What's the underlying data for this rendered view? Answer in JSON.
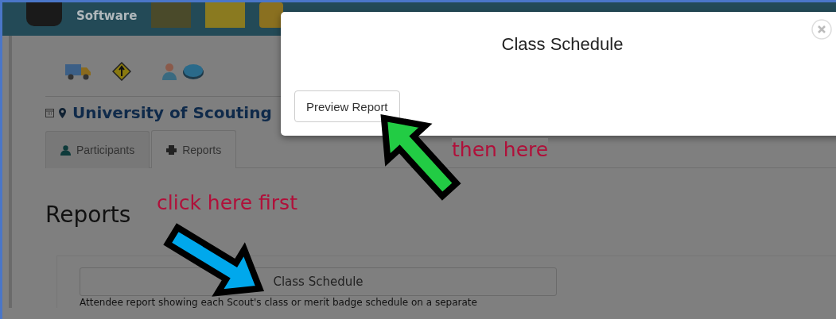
{
  "header": {
    "brand_text": "Software"
  },
  "title": "University of Scouting",
  "tabs": [
    {
      "label": "Participants",
      "selected": false
    },
    {
      "label": "Reports",
      "selected": true
    }
  ],
  "section_heading": "Reports",
  "report": {
    "button": "Class Schedule",
    "description": "Attendee report showing each Scout's class or merit badge schedule on a separate"
  },
  "modal": {
    "title": "Class Schedule",
    "button": "Preview Report"
  },
  "annotations": [
    {
      "text": "then here",
      "color": "#22cc44"
    },
    {
      "text": "click here first",
      "color": "#00a8ec"
    }
  ]
}
